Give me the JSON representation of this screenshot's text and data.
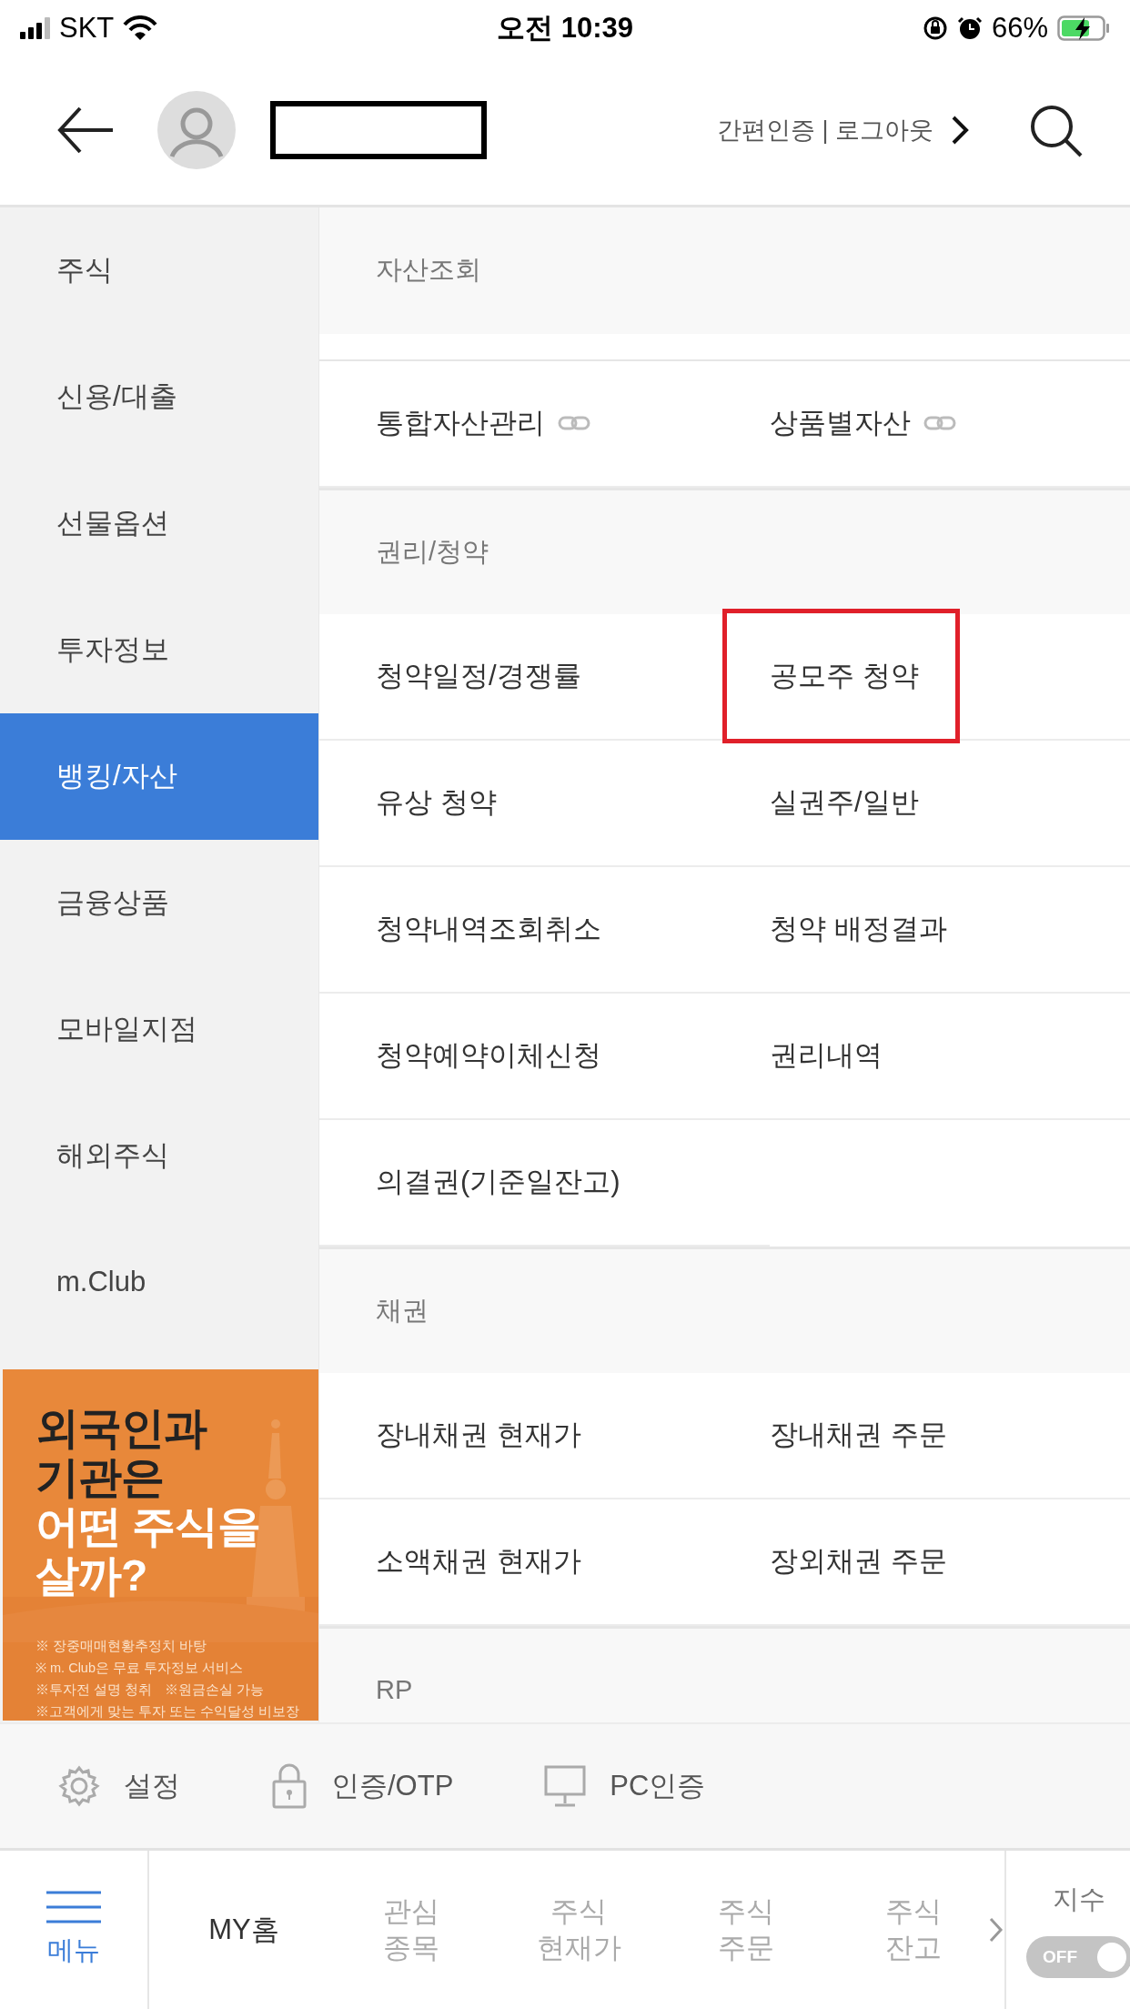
{
  "status_bar": {
    "carrier": "SKT",
    "time": "오전 10:39",
    "battery": "66%"
  },
  "header": {
    "auth_links": "간편인증 | 로그아웃"
  },
  "sidebar": {
    "items": [
      {
        "label": "주식",
        "selected": false
      },
      {
        "label": "신용/대출",
        "selected": false
      },
      {
        "label": "선물옵션",
        "selected": false
      },
      {
        "label": "투자정보",
        "selected": false
      },
      {
        "label": "뱅킹/자산",
        "selected": true
      },
      {
        "label": "금융상품",
        "selected": false
      },
      {
        "label": "모바일지점",
        "selected": false
      },
      {
        "label": "해외주식",
        "selected": false
      },
      {
        "label": "m.Club",
        "selected": false
      }
    ]
  },
  "promo_banner": {
    "headline_dark": [
      "외국인과",
      "기관은"
    ],
    "headline_light": [
      "어떤 주식을",
      "살까?"
    ],
    "notes": [
      [
        "※ 장중매매현황추정치 바탕"
      ],
      [
        "※ m. Club은 무료 투자정보 서비스"
      ],
      [
        "※투자전 설명 청취",
        "※원금손실 가능"
      ],
      [
        "※고객에게 맞는 투자 또는 수익달성 비보장"
      ]
    ]
  },
  "menu_sections": [
    {
      "title": "자산조회",
      "items": [
        {
          "label": "통합자산관리",
          "link": true,
          "highlighted": false
        },
        {
          "label": "상품별자산",
          "link": true,
          "highlighted": false
        }
      ]
    },
    {
      "title": "권리/청약",
      "items": [
        {
          "label": "청약일정/경쟁률",
          "link": false,
          "highlighted": false
        },
        {
          "label": "공모주 청약",
          "link": false,
          "highlighted": true
        },
        {
          "label": "유상 청약",
          "link": false,
          "highlighted": false
        },
        {
          "label": "실권주/일반",
          "link": false,
          "highlighted": false
        },
        {
          "label": "청약내역조회취소",
          "link": false,
          "highlighted": false
        },
        {
          "label": "청약 배정결과",
          "link": false,
          "highlighted": false
        },
        {
          "label": "청약예약이체신청",
          "link": false,
          "highlighted": false
        },
        {
          "label": "권리내역",
          "link": false,
          "highlighted": false
        },
        {
          "label": "의결권(기준일잔고)",
          "link": false,
          "highlighted": false
        }
      ]
    },
    {
      "title": "채권",
      "items": [
        {
          "label": "장내채권 현재가",
          "link": false,
          "highlighted": false
        },
        {
          "label": "장내채권 주문",
          "link": false,
          "highlighted": false
        },
        {
          "label": "소액채권 현재가",
          "link": false,
          "highlighted": false
        },
        {
          "label": "장외채권 주문",
          "link": false,
          "highlighted": false
        }
      ]
    },
    {
      "title": "RP"
    }
  ],
  "quick_settings": [
    {
      "label": "설정",
      "kind": "gear"
    },
    {
      "label": "인증/OTP",
      "kind": "lock"
    },
    {
      "label": "PC인증",
      "kind": "monitor"
    }
  ],
  "bottom_bar": {
    "menu_label": "메뉴",
    "tabs": [
      {
        "lines": [
          "MY홈"
        ],
        "selected": true
      },
      {
        "lines": [
          "관심",
          "종목"
        ],
        "selected": false
      },
      {
        "lines": [
          "주식",
          "현재가"
        ],
        "selected": false
      },
      {
        "lines": [
          "주식",
          "주문"
        ],
        "selected": false
      },
      {
        "lines": [
          "주식",
          "잔고"
        ],
        "selected": false
      }
    ],
    "index_toggle": {
      "label": "지수",
      "text": "OFF",
      "on": false
    }
  }
}
